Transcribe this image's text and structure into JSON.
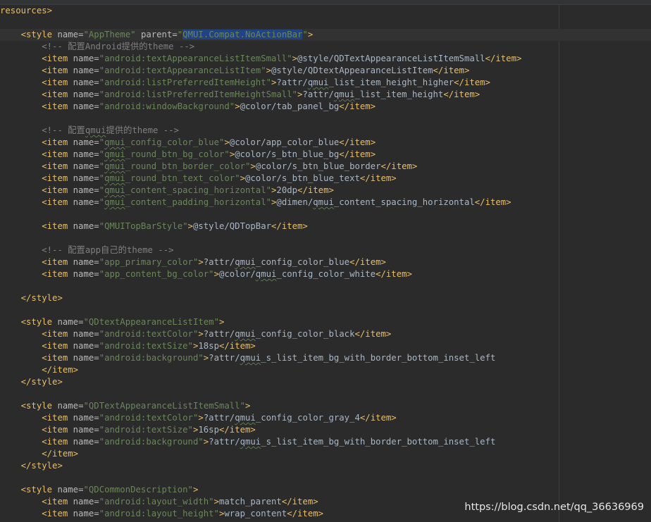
{
  "editor": {
    "language": "xml",
    "colors": {
      "background": "#2b2b2b",
      "tag": "#e8bf6a",
      "attribute": "#bababa",
      "attribute_value": "#6a8759",
      "text": "#a9b7c6",
      "comment": "#808080",
      "selection": "#214283",
      "current_line": "#323232"
    },
    "lines": [
      {
        "indent": 0,
        "tokens": [
          {
            "k": "tag",
            "t": "resources>"
          }
        ]
      },
      {
        "indent": 0,
        "tokens": []
      },
      {
        "indent": 1,
        "current": true,
        "tokens": [
          {
            "k": "tag",
            "t": "<style "
          },
          {
            "k": "attr",
            "t": "name="
          },
          {
            "k": "val",
            "t": "\"AppTheme\""
          },
          {
            "k": "tag",
            "t": " "
          },
          {
            "k": "attr",
            "t": "parent="
          },
          {
            "k": "val",
            "t": "\""
          },
          {
            "k": "val",
            "t": "QMUI.Compat.NoActionBar",
            "sel": true
          },
          {
            "k": "val",
            "t": "\""
          },
          {
            "k": "tag",
            "t": ">"
          }
        ]
      },
      {
        "indent": 2,
        "tokens": [
          {
            "k": "comment",
            "t": "<!-- 配置Android提供的theme -->"
          }
        ]
      },
      {
        "indent": 2,
        "tokens": [
          {
            "k": "tag",
            "t": "<item "
          },
          {
            "k": "attr",
            "t": "name="
          },
          {
            "k": "val",
            "t": "\"android:textAppearanceListItemSmall\""
          },
          {
            "k": "tag",
            "t": ">"
          },
          {
            "k": "text",
            "t": "@style/QDTextAppearanceListItemSmall"
          },
          {
            "k": "tag",
            "t": "</item>"
          }
        ]
      },
      {
        "indent": 2,
        "tokens": [
          {
            "k": "tag",
            "t": "<item "
          },
          {
            "k": "attr",
            "t": "name="
          },
          {
            "k": "val",
            "t": "\"android:textAppearanceListItem\""
          },
          {
            "k": "tag",
            "t": ">"
          },
          {
            "k": "text",
            "t": "@style/QDtextAppearanceListItem"
          },
          {
            "k": "tag",
            "t": "</item>"
          }
        ]
      },
      {
        "indent": 2,
        "tokens": [
          {
            "k": "tag",
            "t": "<item "
          },
          {
            "k": "attr",
            "t": "name="
          },
          {
            "k": "val",
            "t": "\"android:listPreferredItemHeight\""
          },
          {
            "k": "tag",
            "t": ">"
          },
          {
            "k": "text",
            "t": "?attr/"
          },
          {
            "k": "text",
            "t": "qmui",
            "sq": true
          },
          {
            "k": "text",
            "t": "_list_item_height_higher"
          },
          {
            "k": "tag",
            "t": "</item>"
          }
        ]
      },
      {
        "indent": 2,
        "tokens": [
          {
            "k": "tag",
            "t": "<item "
          },
          {
            "k": "attr",
            "t": "name="
          },
          {
            "k": "val",
            "t": "\"android:listPreferredItemHeightSmall\""
          },
          {
            "k": "tag",
            "t": ">"
          },
          {
            "k": "text",
            "t": "?attr/"
          },
          {
            "k": "text",
            "t": "qmui",
            "sq": true
          },
          {
            "k": "text",
            "t": "_list_item_height"
          },
          {
            "k": "tag",
            "t": "</item>"
          }
        ]
      },
      {
        "indent": 2,
        "tokens": [
          {
            "k": "tag",
            "t": "<item "
          },
          {
            "k": "attr",
            "t": "name="
          },
          {
            "k": "val",
            "t": "\"android:windowBackground\""
          },
          {
            "k": "tag",
            "t": ">"
          },
          {
            "k": "text",
            "t": "@color/tab_panel_bg"
          },
          {
            "k": "tag",
            "t": "</item>"
          }
        ]
      },
      {
        "indent": 0,
        "tokens": []
      },
      {
        "indent": 2,
        "tokens": [
          {
            "k": "comment",
            "t": "<!-- 配置"
          },
          {
            "k": "comment",
            "t": "qmui",
            "sq": true
          },
          {
            "k": "comment",
            "t": "提供的theme -->"
          }
        ]
      },
      {
        "indent": 2,
        "tokens": [
          {
            "k": "tag",
            "t": "<item "
          },
          {
            "k": "attr",
            "t": "name="
          },
          {
            "k": "val",
            "t": "\""
          },
          {
            "k": "val",
            "t": "qmui",
            "sq": true
          },
          {
            "k": "val",
            "t": "_config_color_blue\""
          },
          {
            "k": "tag",
            "t": ">"
          },
          {
            "k": "text",
            "t": "@color/app_color_blue"
          },
          {
            "k": "tag",
            "t": "</item>"
          }
        ]
      },
      {
        "indent": 2,
        "tokens": [
          {
            "k": "tag",
            "t": "<item "
          },
          {
            "k": "attr",
            "t": "name="
          },
          {
            "k": "val",
            "t": "\""
          },
          {
            "k": "val",
            "t": "qmui",
            "sq": true
          },
          {
            "k": "val",
            "t": "_round_btn_bg_color\""
          },
          {
            "k": "tag",
            "t": ">"
          },
          {
            "k": "text",
            "t": "@color/s_btn_blue_bg"
          },
          {
            "k": "tag",
            "t": "</item>"
          }
        ]
      },
      {
        "indent": 2,
        "tokens": [
          {
            "k": "tag",
            "t": "<item "
          },
          {
            "k": "attr",
            "t": "name="
          },
          {
            "k": "val",
            "t": "\""
          },
          {
            "k": "val",
            "t": "qmui",
            "sq": true
          },
          {
            "k": "val",
            "t": "_round_btn_border_color\""
          },
          {
            "k": "tag",
            "t": ">"
          },
          {
            "k": "text",
            "t": "@color/s_btn_blue_border"
          },
          {
            "k": "tag",
            "t": "</item>"
          }
        ]
      },
      {
        "indent": 2,
        "tokens": [
          {
            "k": "tag",
            "t": "<item "
          },
          {
            "k": "attr",
            "t": "name="
          },
          {
            "k": "val",
            "t": "\""
          },
          {
            "k": "val",
            "t": "qmui",
            "sq": true
          },
          {
            "k": "val",
            "t": "_round_btn_text_color\""
          },
          {
            "k": "tag",
            "t": ">"
          },
          {
            "k": "text",
            "t": "@color/s_btn_blue_text"
          },
          {
            "k": "tag",
            "t": "</item>"
          }
        ]
      },
      {
        "indent": 2,
        "tokens": [
          {
            "k": "tag",
            "t": "<item "
          },
          {
            "k": "attr",
            "t": "name="
          },
          {
            "k": "val",
            "t": "\""
          },
          {
            "k": "val",
            "t": "qmui",
            "sq": true
          },
          {
            "k": "val",
            "t": "_content_spacing_horizontal\""
          },
          {
            "k": "tag",
            "t": ">"
          },
          {
            "k": "text",
            "t": "20dp"
          },
          {
            "k": "tag",
            "t": "</item>"
          }
        ]
      },
      {
        "indent": 2,
        "tokens": [
          {
            "k": "tag",
            "t": "<item "
          },
          {
            "k": "attr",
            "t": "name="
          },
          {
            "k": "val",
            "t": "\""
          },
          {
            "k": "val",
            "t": "qmui",
            "sq": true
          },
          {
            "k": "val",
            "t": "_content_padding_horizontal\""
          },
          {
            "k": "tag",
            "t": ">"
          },
          {
            "k": "text",
            "t": "@dimen/"
          },
          {
            "k": "text",
            "t": "qmui",
            "sq": true
          },
          {
            "k": "text",
            "t": "_content_spacing_horizontal"
          },
          {
            "k": "tag",
            "t": "</item>"
          }
        ]
      },
      {
        "indent": 0,
        "tokens": []
      },
      {
        "indent": 2,
        "tokens": [
          {
            "k": "tag",
            "t": "<item "
          },
          {
            "k": "attr",
            "t": "name="
          },
          {
            "k": "val",
            "t": "\"QMUITopBarStyle\""
          },
          {
            "k": "tag",
            "t": ">"
          },
          {
            "k": "text",
            "t": "@style/QDTopBar"
          },
          {
            "k": "tag",
            "t": "</item>"
          }
        ]
      },
      {
        "indent": 0,
        "tokens": []
      },
      {
        "indent": 2,
        "tokens": [
          {
            "k": "comment",
            "t": "<!-- 配置app自己的theme -->"
          }
        ]
      },
      {
        "indent": 2,
        "tokens": [
          {
            "k": "tag",
            "t": "<item "
          },
          {
            "k": "attr",
            "t": "name="
          },
          {
            "k": "val",
            "t": "\"app_primary_color\""
          },
          {
            "k": "tag",
            "t": ">"
          },
          {
            "k": "text",
            "t": "?attr/"
          },
          {
            "k": "text",
            "t": "qmui",
            "sq": true
          },
          {
            "k": "text",
            "t": "_config_color_blue"
          },
          {
            "k": "tag",
            "t": "</item>"
          }
        ]
      },
      {
        "indent": 2,
        "tokens": [
          {
            "k": "tag",
            "t": "<item "
          },
          {
            "k": "attr",
            "t": "name="
          },
          {
            "k": "val",
            "t": "\"app_content_bg_color\""
          },
          {
            "k": "tag",
            "t": ">"
          },
          {
            "k": "text",
            "t": "@color/"
          },
          {
            "k": "text",
            "t": "qmui",
            "sq": true
          },
          {
            "k": "text",
            "t": "_config_color_white"
          },
          {
            "k": "tag",
            "t": "</item>"
          }
        ]
      },
      {
        "indent": 0,
        "tokens": []
      },
      {
        "indent": 1,
        "tokens": [
          {
            "k": "tag",
            "t": "</style>"
          }
        ]
      },
      {
        "indent": 0,
        "tokens": []
      },
      {
        "indent": 1,
        "tokens": [
          {
            "k": "tag",
            "t": "<style "
          },
          {
            "k": "attr",
            "t": "name="
          },
          {
            "k": "val",
            "t": "\"QDtextAppearanceListItem\""
          },
          {
            "k": "tag",
            "t": ">"
          }
        ]
      },
      {
        "indent": 2,
        "tokens": [
          {
            "k": "tag",
            "t": "<item "
          },
          {
            "k": "attr",
            "t": "name="
          },
          {
            "k": "val",
            "t": "\"android:textColor\""
          },
          {
            "k": "tag",
            "t": ">"
          },
          {
            "k": "text",
            "t": "?attr/"
          },
          {
            "k": "text",
            "t": "qmui",
            "sq": true
          },
          {
            "k": "text",
            "t": "_config_color_black"
          },
          {
            "k": "tag",
            "t": "</item>"
          }
        ]
      },
      {
        "indent": 2,
        "tokens": [
          {
            "k": "tag",
            "t": "<item "
          },
          {
            "k": "attr",
            "t": "name="
          },
          {
            "k": "val",
            "t": "\"android:textSize\""
          },
          {
            "k": "tag",
            "t": ">"
          },
          {
            "k": "text",
            "t": "18sp"
          },
          {
            "k": "tag",
            "t": "</item>"
          }
        ]
      },
      {
        "indent": 2,
        "tokens": [
          {
            "k": "tag",
            "t": "<item "
          },
          {
            "k": "attr",
            "t": "name="
          },
          {
            "k": "val",
            "t": "\"android:background\""
          },
          {
            "k": "tag",
            "t": ">"
          },
          {
            "k": "text",
            "t": "?attr/"
          },
          {
            "k": "text",
            "t": "qmui",
            "sq": true
          },
          {
            "k": "text",
            "t": "_s_list_item_bg_with_border_bottom_inset_left"
          }
        ]
      },
      {
        "indent": 2,
        "tokens": [
          {
            "k": "tag",
            "t": "</item>"
          }
        ]
      },
      {
        "indent": 1,
        "tokens": [
          {
            "k": "tag",
            "t": "</style>"
          }
        ]
      },
      {
        "indent": 0,
        "tokens": []
      },
      {
        "indent": 1,
        "tokens": [
          {
            "k": "tag",
            "t": "<style "
          },
          {
            "k": "attr",
            "t": "name="
          },
          {
            "k": "val",
            "t": "\"QDTextAppearanceListItemSmall\""
          },
          {
            "k": "tag",
            "t": ">"
          }
        ]
      },
      {
        "indent": 2,
        "tokens": [
          {
            "k": "tag",
            "t": "<item "
          },
          {
            "k": "attr",
            "t": "name="
          },
          {
            "k": "val",
            "t": "\"android:textColor\""
          },
          {
            "k": "tag",
            "t": ">"
          },
          {
            "k": "text",
            "t": "?attr/"
          },
          {
            "k": "text",
            "t": "qmui",
            "sq": true
          },
          {
            "k": "text",
            "t": "_config_color_gray_4"
          },
          {
            "k": "tag",
            "t": "</item>"
          }
        ]
      },
      {
        "indent": 2,
        "tokens": [
          {
            "k": "tag",
            "t": "<item "
          },
          {
            "k": "attr",
            "t": "name="
          },
          {
            "k": "val",
            "t": "\"android:textSize\""
          },
          {
            "k": "tag",
            "t": ">"
          },
          {
            "k": "text",
            "t": "16sp"
          },
          {
            "k": "tag",
            "t": "</item>"
          }
        ]
      },
      {
        "indent": 2,
        "tokens": [
          {
            "k": "tag",
            "t": "<item "
          },
          {
            "k": "attr",
            "t": "name="
          },
          {
            "k": "val",
            "t": "\"android:background\""
          },
          {
            "k": "tag",
            "t": ">"
          },
          {
            "k": "text",
            "t": "?attr/"
          },
          {
            "k": "text",
            "t": "qmui",
            "sq": true
          },
          {
            "k": "text",
            "t": "_s_list_item_bg_with_border_bottom_inset_left"
          }
        ]
      },
      {
        "indent": 2,
        "tokens": [
          {
            "k": "tag",
            "t": "</item>"
          }
        ]
      },
      {
        "indent": 1,
        "tokens": [
          {
            "k": "tag",
            "t": "</style>"
          }
        ]
      },
      {
        "indent": 0,
        "tokens": []
      },
      {
        "indent": 1,
        "tokens": [
          {
            "k": "tag",
            "t": "<style "
          },
          {
            "k": "attr",
            "t": "name="
          },
          {
            "k": "val",
            "t": "\"QDCommonDescription\""
          },
          {
            "k": "tag",
            "t": ">"
          }
        ]
      },
      {
        "indent": 2,
        "tokens": [
          {
            "k": "tag",
            "t": "<item "
          },
          {
            "k": "attr",
            "t": "name="
          },
          {
            "k": "val",
            "t": "\"android:layout_width\""
          },
          {
            "k": "tag",
            "t": ">"
          },
          {
            "k": "text",
            "t": "match_parent"
          },
          {
            "k": "tag",
            "t": "</item>"
          }
        ]
      },
      {
        "indent": 2,
        "tokens": [
          {
            "k": "tag",
            "t": "<item "
          },
          {
            "k": "attr",
            "t": "name="
          },
          {
            "k": "val",
            "t": "\"android:layout_height\""
          },
          {
            "k": "tag",
            "t": ">"
          },
          {
            "k": "text",
            "t": "wrap_content"
          },
          {
            "k": "tag",
            "t": "</item>"
          }
        ]
      }
    ]
  },
  "watermark": {
    "text": "https://blog.csdn.net/qq_36636969"
  }
}
